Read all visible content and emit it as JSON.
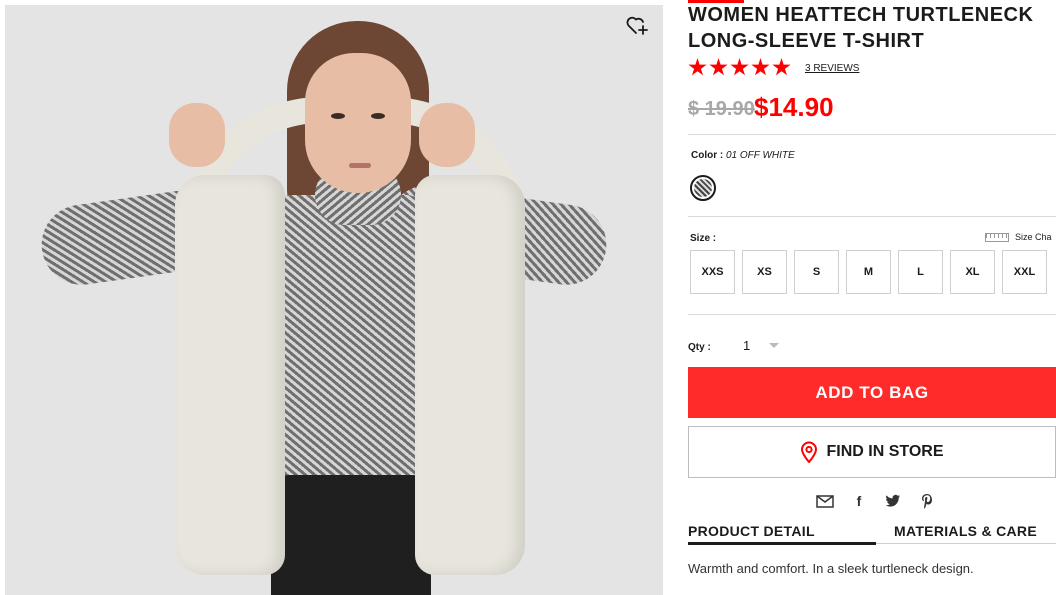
{
  "product": {
    "title_line1": "WOMEN HEATTECH TURTLENECK",
    "title_line2": "LONG-SLEEVE T-SHIRT",
    "rating": 5,
    "reviews_label": "3 REVIEWS",
    "original_price": "$ 19.90",
    "sale_price": "$14.90"
  },
  "color": {
    "label": "Color :",
    "value": "01 OFF WHITE"
  },
  "size": {
    "label": "Size :",
    "chart_label": "Size Cha",
    "options": [
      "XXS",
      "XS",
      "S",
      "M",
      "L",
      "XL",
      "XXL"
    ]
  },
  "qty": {
    "label": "Qty :",
    "value": "1"
  },
  "actions": {
    "add_to_bag": "ADD TO BAG",
    "find_in_store": "FIND IN STORE"
  },
  "share": {
    "icons": [
      "email-icon",
      "facebook-icon",
      "twitter-icon",
      "pinterest-icon"
    ]
  },
  "tabs": {
    "product_detail": "PRODUCT DETAIL",
    "materials_care": "MATERIALS & CARE"
  },
  "description": "Warmth and comfort. In a sleek turtleneck design.",
  "colors": {
    "accent": "#ff0000",
    "button": "#ff2a2a",
    "old_price": "#a8a8a8"
  }
}
